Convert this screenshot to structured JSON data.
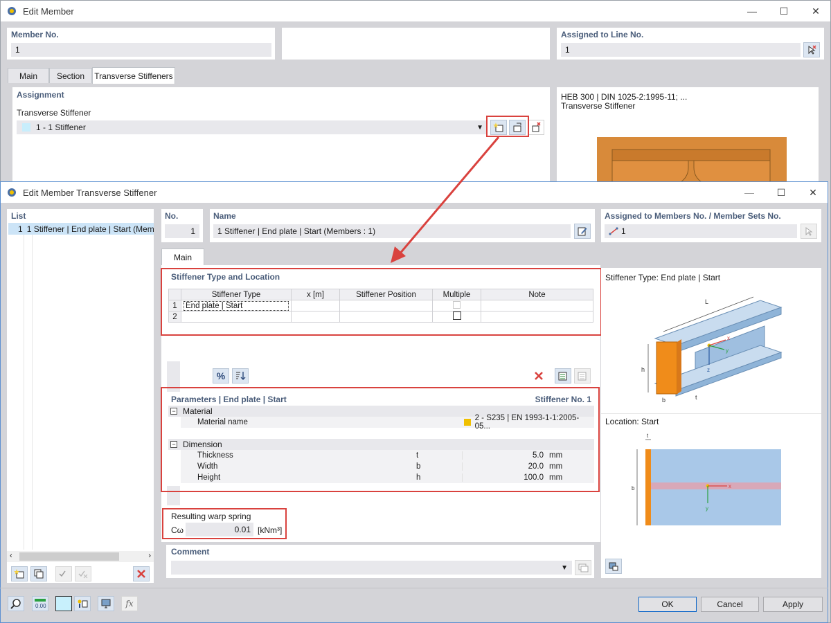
{
  "outer": {
    "title": "Edit Member",
    "member_no_label": "Member No.",
    "member_no_value": "1",
    "assigned_line_label": "Assigned to Line No.",
    "assigned_line_value": "1",
    "tabs": [
      {
        "label": "Main"
      },
      {
        "label": "Section"
      },
      {
        "label": "Transverse Stiffeners"
      }
    ],
    "assignment_label": "Assignment",
    "stiffener_label": "Transverse Stiffener",
    "stiffener_value": "1 - 1 Stiffener",
    "section_line1": "HEB 300 | DIN 1025-2:1995-11; ...",
    "section_line2": "Transverse Stiffener"
  },
  "dialog": {
    "title": "Edit Member Transverse Stiffener",
    "list_label": "List",
    "list_item_no": "1",
    "list_item_text": "1 Stiffener | End plate | Start (Mem",
    "no_label": "No.",
    "no_value": "1",
    "name_label": "Name",
    "name_value": "1 Stiffener | End plate | Start (Members : 1)",
    "assigned_label": "Assigned to Members No. / Member Sets No.",
    "assigned_value": "1",
    "tab_main": "Main",
    "type_location_label": "Stiffener Type and Location",
    "table_headers": [
      "Stiffener Type",
      "x [m]",
      "Stiffener Position",
      "Multiple",
      "Note"
    ],
    "table_rows": [
      {
        "no": "1",
        "type": "End plate | Start"
      },
      {
        "no": "2",
        "type": ""
      }
    ],
    "params_label": "Parameters | End plate | Start",
    "params_right": "Stiffener No. 1",
    "material_section": "Material",
    "material_name_label": "Material name",
    "material_name_value": "2 - S235 | EN 1993-1-1:2005-05...",
    "material_color": "#f0c000",
    "dimension_section": "Dimension",
    "dims": [
      {
        "name": "Thickness",
        "sym": "t",
        "value": "5.0",
        "unit": "mm"
      },
      {
        "name": "Width",
        "sym": "b",
        "value": "20.0",
        "unit": "mm"
      },
      {
        "name": "Height",
        "sym": "h",
        "value": "100.0",
        "unit": "mm"
      }
    ],
    "warp_label": "Resulting warp spring",
    "warp_sym": "Cω",
    "warp_value": "0.01",
    "warp_unit": "[kNm³]",
    "comment_label": "Comment",
    "type_caption": "Stiffener Type: End plate | Start",
    "location_caption": "Location: Start",
    "ok_label": "OK",
    "cancel_label": "Cancel",
    "apply_label": "Apply"
  },
  "colors": {
    "accent_red": "#d9423e",
    "label_blue": "#4a5d7a",
    "steel": "#a9c8e8",
    "plate": "#f08c1a"
  }
}
